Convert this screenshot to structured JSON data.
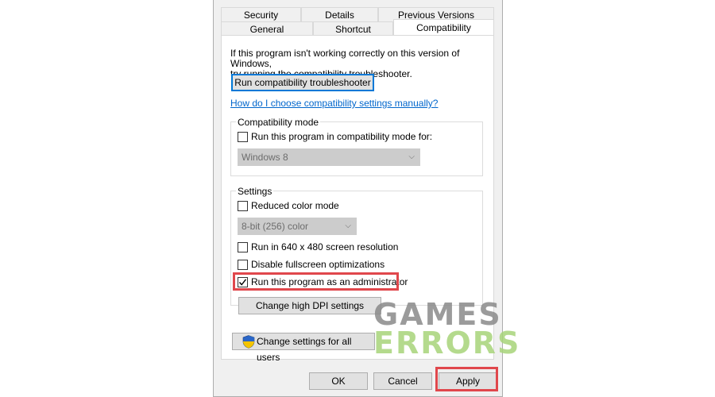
{
  "tabs_row1": [
    "Security",
    "Details",
    "Previous Versions"
  ],
  "tabs_row2": [
    "General",
    "Shortcut",
    "Compatibility"
  ],
  "intro_text_line1": "If this program isn't working correctly on this version of Windows,",
  "intro_text_line2": "try running the compatibility troubleshooter.",
  "troubleshooter_button": "Run compatibility troubleshooter",
  "manual_link": "How do I choose compatibility settings manually?",
  "compat_mode": {
    "title": "Compatibility mode",
    "checkbox_label": "Run this program in compatibility mode for:",
    "checked": false,
    "select_value": "Windows 8"
  },
  "settings": {
    "title": "Settings",
    "reduced_color": {
      "label": "Reduced color mode",
      "checked": false
    },
    "color_select_value": "8-bit (256) color",
    "res_640": {
      "label": "Run in 640 x 480 screen resolution",
      "checked": false
    },
    "fullscreen_opt": {
      "label": "Disable fullscreen optimizations",
      "checked": false
    },
    "run_admin": {
      "label": "Run this program as an administrator",
      "checked": true
    },
    "dpi_button": "Change high DPI settings"
  },
  "all_users_button": "Change settings for all users",
  "footer": {
    "ok": "OK",
    "cancel": "Cancel",
    "apply": "Apply"
  },
  "watermark": {
    "line1": "GAMES",
    "line2": "ERRORS"
  },
  "colors": {
    "highlight": "#e0474c",
    "link": "#0066cc",
    "focus": "#0078d7"
  },
  "icons": {
    "shield": "uac-shield-icon",
    "checkmark": "checkmark-icon",
    "dropdown": "chevron-down-icon"
  }
}
